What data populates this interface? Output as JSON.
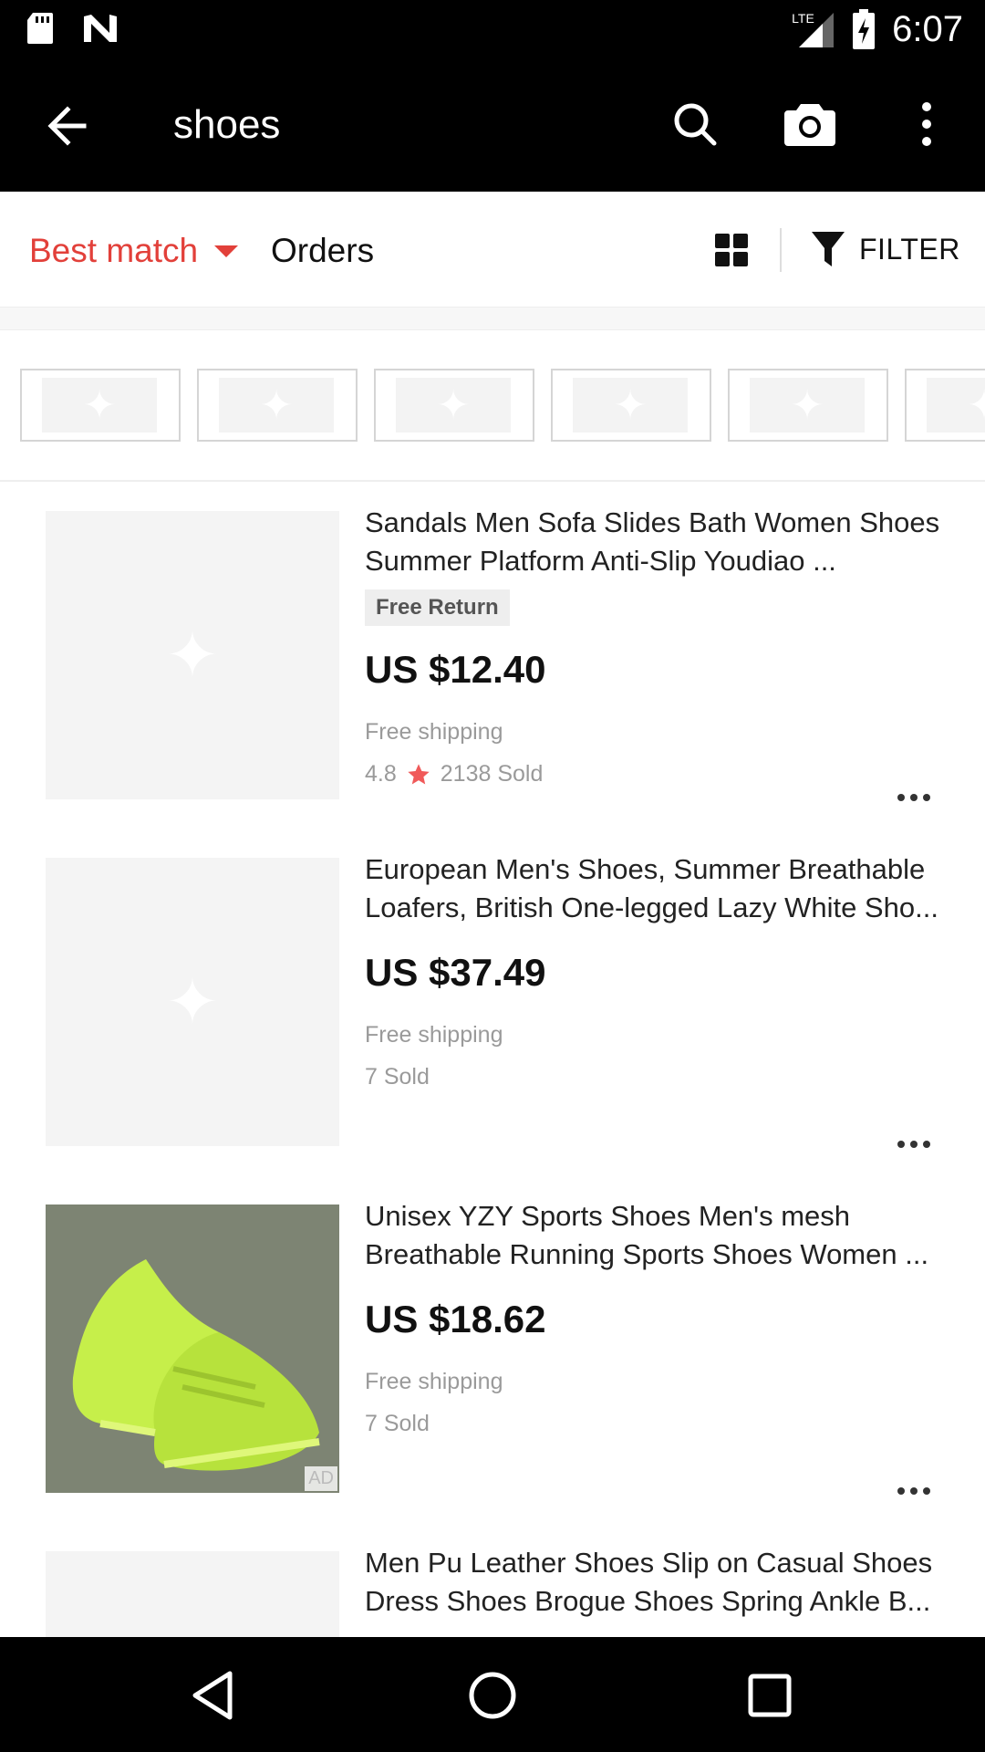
{
  "status_bar": {
    "time": "6:07",
    "network": "LTE"
  },
  "app_bar": {
    "query": "shoes"
  },
  "sort_bar": {
    "best_match": "Best match",
    "orders": "Orders",
    "filter": "FILTER"
  },
  "products": [
    {
      "title": "Sandals Men Sofa Slides Bath Women Shoes Summer Platform Anti-Slip Youdiao ...",
      "badge": "Free Return",
      "price": "US $12.40",
      "shipping": "Free shipping",
      "rating": "4.8",
      "sold": "2138 Sold"
    },
    {
      "title": "European Men's Shoes, Summer Breathable Loafers, British One-legged Lazy White Sho...",
      "price": "US $37.49",
      "shipping": "Free shipping",
      "sold": "7 Sold"
    },
    {
      "title": "Unisex YZY Sports Shoes Men's mesh Breathable Running Sports Shoes Women ...",
      "price": "US $18.62",
      "shipping": "Free shipping",
      "sold": "7 Sold",
      "ad_label": "AD"
    },
    {
      "title": "Men Pu Leather Shoes Slip on Casual Shoes Dress Shoes Brogue Shoes Spring Ankle B..."
    }
  ],
  "colors": {
    "accent": "#e2403a",
    "star": "#f05a5a"
  },
  "icons": [
    "sd-card-icon",
    "n-notification-icon",
    "signal-icon",
    "battery-icon",
    "back-arrow-icon",
    "search-icon",
    "camera-icon",
    "more-vert-icon",
    "grid-view-icon",
    "filter-icon",
    "placeholder-sparkle-icon",
    "star-icon",
    "more-horiz-icon",
    "nav-back-icon",
    "nav-home-icon",
    "nav-recents-icon"
  ]
}
